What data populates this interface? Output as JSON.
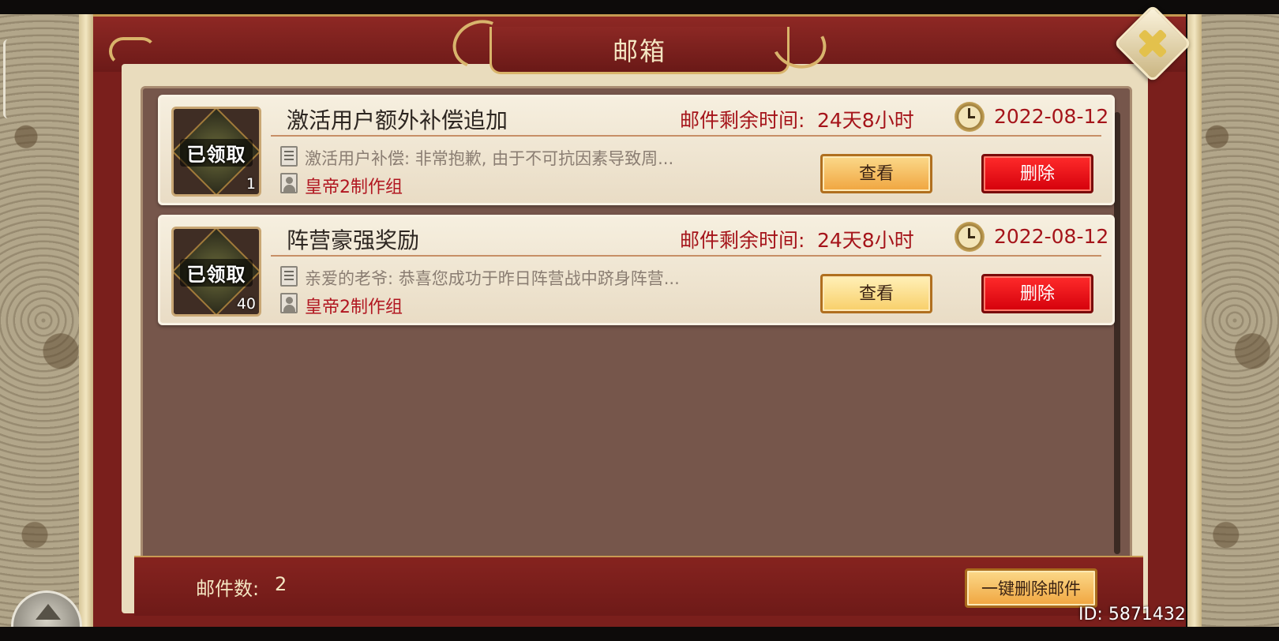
{
  "window": {
    "title": "邮箱"
  },
  "mails": [
    {
      "title": "激活用户额外补偿追加",
      "remain_label": "邮件剩余时间:",
      "remain_value": "24天8小时",
      "date": "2022-08-12",
      "preview": "激活用户补偿: 非常抱歉, 由于不可抗因素导致周...",
      "sender": "皇帝2制作组",
      "claimed_tag": "已领取",
      "item_count": "1",
      "view_label": "查看",
      "delete_label": "删除"
    },
    {
      "title": "阵营豪强奖励",
      "remain_label": "邮件剩余时间:",
      "remain_value": "24天8小时",
      "date": "2022-08-12",
      "preview": "亲爱的老爷: 恭喜您成功于昨日阵营战中跻身阵营...",
      "sender": "皇帝2制作组",
      "claimed_tag": "已领取",
      "item_count": "40",
      "view_label": "查看",
      "delete_label": "删除"
    }
  ],
  "footer": {
    "count_label": "邮件数:",
    "count_value": "2",
    "delete_all_label": "一键删除邮件",
    "player_id": "ID: 5871432"
  },
  "colors": {
    "frame_red": "#7a1f1c",
    "accent_red_text": "#a5141a",
    "gold": "#d9b46a",
    "delete_red": "#e0000e",
    "view_gold": "#f0a53f"
  },
  "icons": [
    "close-icon",
    "clock-icon",
    "document-icon",
    "person-icon",
    "home-arrow-icon"
  ]
}
